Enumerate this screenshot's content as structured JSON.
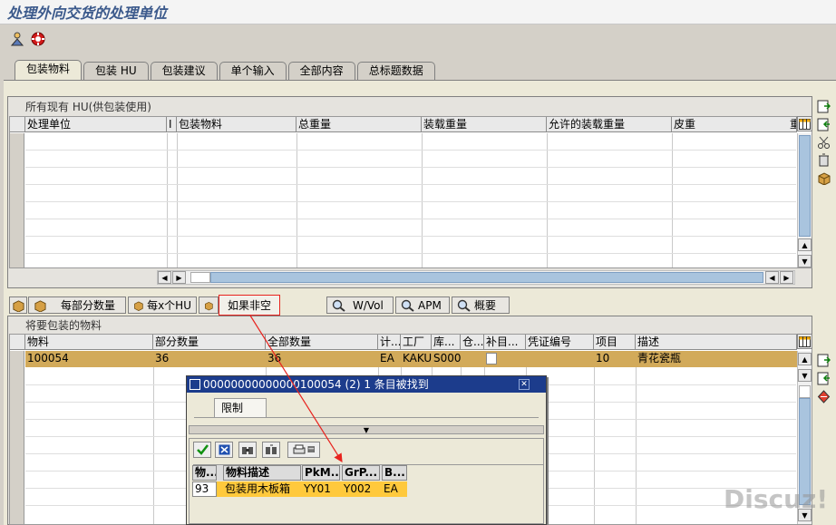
{
  "window": {
    "title": "处理外向交货的处理单位"
  },
  "tabs": [
    "包装物料",
    "包装 HU",
    "包装建议",
    "单个输入",
    "全部内容",
    "总标题数据"
  ],
  "upper": {
    "group_title": "所有现有 HU(供包装使用)",
    "columns": [
      "处理单位",
      "I",
      "包装物料",
      "总重量",
      "装载重量",
      "允许的装载重量",
      "皮重",
      "重"
    ]
  },
  "buttons": {
    "per_partial": "每部分数量",
    "per_x_hu": "每x个HU",
    "if_not_empty": "如果非空",
    "wvol": "W/Vol",
    "apm": "APM",
    "overview": "概要"
  },
  "lower": {
    "group_title": "将要包装的物料",
    "columns": [
      "物料",
      "部分数量",
      "全部数量",
      "计...",
      "工厂",
      "库...",
      "仓...",
      "补目...",
      "凭证编号",
      "项目",
      "描述"
    ],
    "row": {
      "material": "100054",
      "partial_qty": "36",
      "total_qty": "36",
      "unit": "EA",
      "plant": "KAKU",
      "storage": "S000",
      "doc": "",
      "item": "10",
      "desc": "青花瓷瓶"
    }
  },
  "popup": {
    "title": "00000000000000100054 (2)   1 条目被找到",
    "restrict_tab": "限制",
    "columns": [
      "物...",
      "物料描述",
      "PkM...",
      "GrP...",
      "B..."
    ],
    "row": {
      "c1": "93",
      "c2": "包装用木板箱",
      "c3": "YY01",
      "c4": "Y002",
      "c5": "EA"
    }
  },
  "watermark": "Discuz!",
  "colors": {
    "selected_row": "#d2aa5a",
    "popup_title": "#1c3c8c",
    "popup_row": "#ffc93c",
    "annotation": "#e8231e"
  }
}
